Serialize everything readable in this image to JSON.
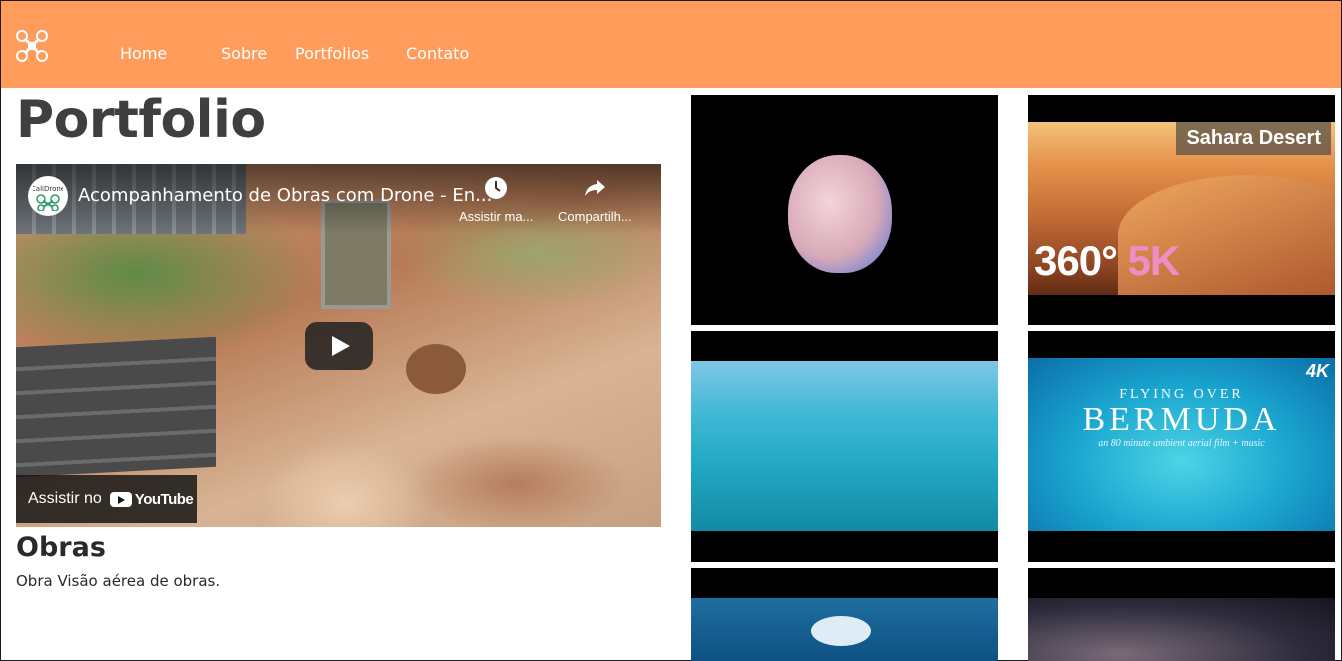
{
  "nav": {
    "logo_icon": "drone-icon",
    "links": [
      "Home",
      "Sobre",
      "Portfolios",
      "Contato"
    ]
  },
  "page": {
    "title": "Portfolio"
  },
  "video": {
    "channel_icon": "calidrone-logo",
    "channel_name": "CaliDrone",
    "title": "Acompanhamento de Obras com Drone - En...",
    "watch_later": "Assistir ma...",
    "share": "Compartilh...",
    "watch_on": "Assistir no",
    "youtube": "YouTube"
  },
  "card": {
    "title": "Obras",
    "description": "Obra Visão aérea de obras."
  },
  "thumbnails": [
    {
      "name": "planet"
    },
    {
      "name": "sahara",
      "label": "Sahara Desert",
      "big_a": "360°",
      "big_b": "5K"
    },
    {
      "name": "reef"
    },
    {
      "name": "bermuda",
      "over": "FLYING OVER",
      "title": "BERMUDA",
      "sub": "an 80 minute ambient aerial film + music",
      "badge": "4K"
    },
    {
      "name": "clouds"
    },
    {
      "name": "stars"
    }
  ],
  "colors": {
    "navbar": "#ff9c5c",
    "title": "#3f3f3f"
  }
}
